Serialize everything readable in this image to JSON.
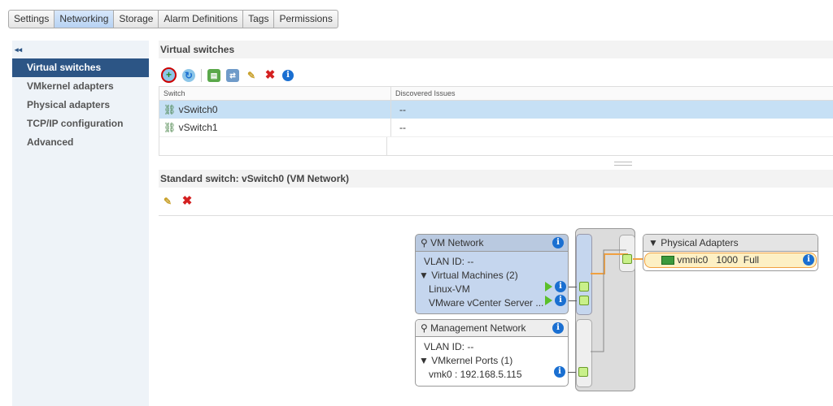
{
  "tabs": [
    "Settings",
    "Networking",
    "Storage",
    "Alarm Definitions",
    "Tags",
    "Permissions"
  ],
  "sidebar": {
    "collapse": "◂◂",
    "items": [
      "Virtual switches",
      "VMkernel adapters",
      "Physical adapters",
      "TCP/IP configuration",
      "Advanced"
    ]
  },
  "switches": {
    "title": "Virtual switches",
    "columns": [
      "Switch",
      "Discovered Issues"
    ],
    "rows": [
      {
        "name": "vSwitch0",
        "issues": "--"
      },
      {
        "name": "vSwitch1",
        "issues": "--"
      }
    ]
  },
  "detail": {
    "title": "Standard switch: vSwitch0 (VM Network)"
  },
  "vm_network": {
    "title": "VM Network",
    "vlan": "VLAN ID: --",
    "group": "▼ Virtual Machines (2)",
    "items": [
      "Linux-VM",
      "VMware vCenter Server ..."
    ]
  },
  "mgmt_network": {
    "title": "Management Network",
    "vlan": "VLAN ID: --",
    "group": "▼ VMkernel Ports (1)",
    "items": [
      "vmk0 : 192.168.5.115"
    ]
  },
  "physical": {
    "title": "▼  Physical Adapters",
    "nic": "vmnic0",
    "speed": "1000",
    "duplex": "Full"
  },
  "info_glyph": "i"
}
